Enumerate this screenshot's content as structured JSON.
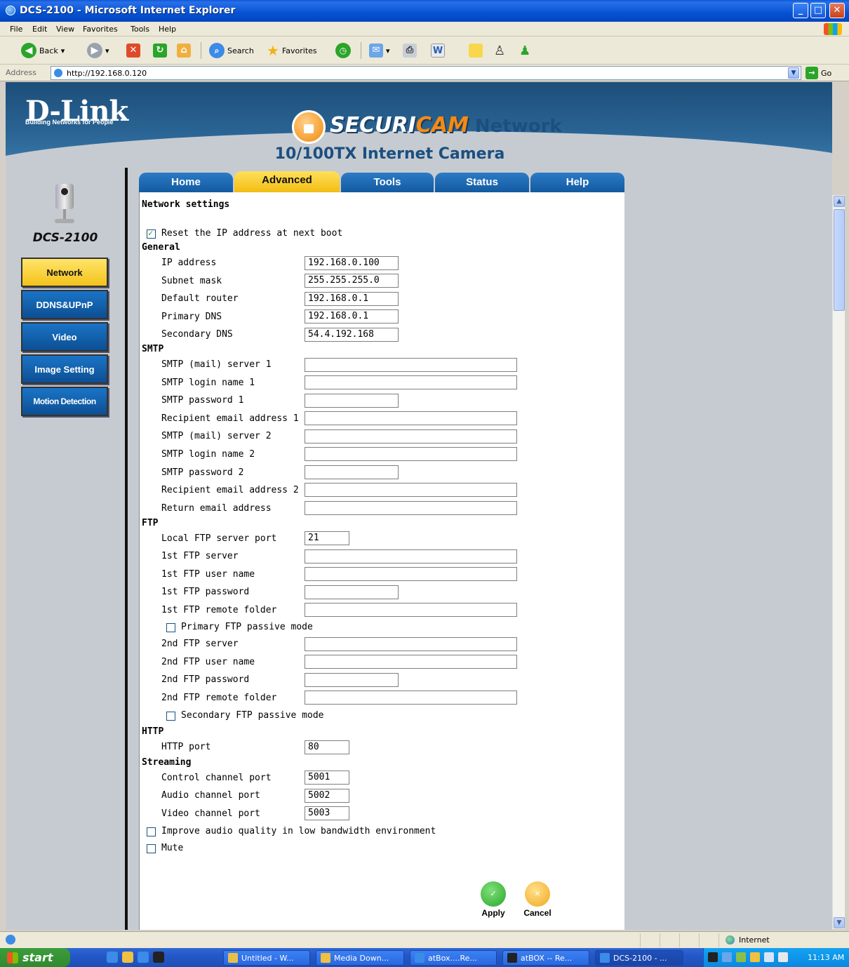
{
  "window": {
    "title": "DCS-2100 - Microsoft Internet Explorer",
    "controls": {
      "minimize": "_",
      "maximize": "□",
      "close": "✕"
    }
  },
  "menu": [
    "File",
    "Edit",
    "View",
    "Favorites",
    "Tools",
    "Help"
  ],
  "toolbar": {
    "back": "Back",
    "search": "Search",
    "favorites": "Favorites"
  },
  "address": {
    "label": "Address",
    "url": "http://192.168.0.120",
    "go": "Go"
  },
  "banner": {
    "logo": "D-Link",
    "tagline": "Building Networks for People",
    "brand_a": "SECURI",
    "brand_b": "CAM",
    "brand_c": " Network",
    "product": "10/100TX Internet Camera"
  },
  "sidebar": {
    "model": "DCS-2100",
    "items": [
      {
        "label": "Network",
        "active": true
      },
      {
        "label": "DDNS&UPnP",
        "active": false
      },
      {
        "label": "Video",
        "active": false
      },
      {
        "label": "Image Setting",
        "active": false
      },
      {
        "label": "Motion Detection",
        "active": false
      }
    ]
  },
  "tabs": [
    {
      "label": "Home",
      "active": false
    },
    {
      "label": "Advanced",
      "active": true
    },
    {
      "label": "Tools",
      "active": false
    },
    {
      "label": "Status",
      "active": false
    },
    {
      "label": "Help",
      "active": false
    }
  ],
  "form": {
    "title": "Network settings",
    "reset_ip": {
      "label": "Reset the IP address at next boot",
      "checked": true
    },
    "general": {
      "heading": "General",
      "ip_label": "IP address",
      "ip": "192.168.0.100",
      "subnet_label": "Subnet mask",
      "subnet": "255.255.255.0",
      "router_label": "Default router",
      "router": "192.168.0.1",
      "dns1_label": "Primary DNS",
      "dns1": "192.168.0.1",
      "dns2_label": "Secondary DNS",
      "dns2": "54.4.192.168"
    },
    "smtp": {
      "heading": "SMTP",
      "server1_label": "SMTP (mail) server 1",
      "server1": "",
      "login1_label": "SMTP login name 1",
      "login1": "",
      "pass1_label": "SMTP password 1",
      "pass1": "",
      "recip1_label": "Recipient email address 1",
      "recip1": "",
      "server2_label": "SMTP (mail) server 2",
      "server2": "",
      "login2_label": "SMTP login name 2",
      "login2": "",
      "pass2_label": "SMTP password 2",
      "pass2": "",
      "recip2_label": "Recipient email address 2",
      "recip2": "",
      "return_label": "Return email address",
      "return": ""
    },
    "ftp": {
      "heading": "FTP",
      "port_label": "Local FTP server port",
      "port": "21",
      "s1_label": "1st FTP server",
      "s1": "",
      "u1_label": "1st FTP user name",
      "u1": "",
      "p1_label": "1st FTP password",
      "p1": "",
      "f1_label": "1st FTP remote folder",
      "f1": "",
      "passive1": {
        "label": "Primary FTP passive mode",
        "checked": false
      },
      "s2_label": "2nd FTP server",
      "s2": "",
      "u2_label": "2nd FTP user name",
      "u2": "",
      "p2_label": "2nd FTP password",
      "p2": "",
      "f2_label": "2nd FTP remote folder",
      "f2": "",
      "passive2": {
        "label": "Secondary FTP passive mode",
        "checked": false
      }
    },
    "http": {
      "heading": "HTTP",
      "port_label": "HTTP port",
      "port": "80"
    },
    "streaming": {
      "heading": "Streaming",
      "control_label": "Control channel port",
      "control": "5001",
      "audio_label": "Audio channel port",
      "audio": "5002",
      "video_label": "Video channel port",
      "video": "5003"
    },
    "improve_audio": {
      "label": "Improve audio quality in low bandwidth environment",
      "checked": false
    },
    "mute": {
      "label": "Mute",
      "checked": false
    },
    "apply": "Apply",
    "cancel": "Cancel"
  },
  "statusbar": {
    "zone": "Internet"
  },
  "taskbar": {
    "start": "start",
    "tasks": [
      "Untitled - W...",
      "Media Down...",
      "atBox....Re...",
      "atBOX -- Re...",
      "DCS-2100 - ..."
    ],
    "clock": "11:13 AM"
  },
  "colors": {
    "tab_active": "#f2bd13",
    "tab_inactive": "#135aa0",
    "sidebar_active": "#f3c21a",
    "sidebar_inactive": "#0d4f93",
    "apply_icon": "#2aa52a",
    "cancel_icon": "#f0a820"
  }
}
